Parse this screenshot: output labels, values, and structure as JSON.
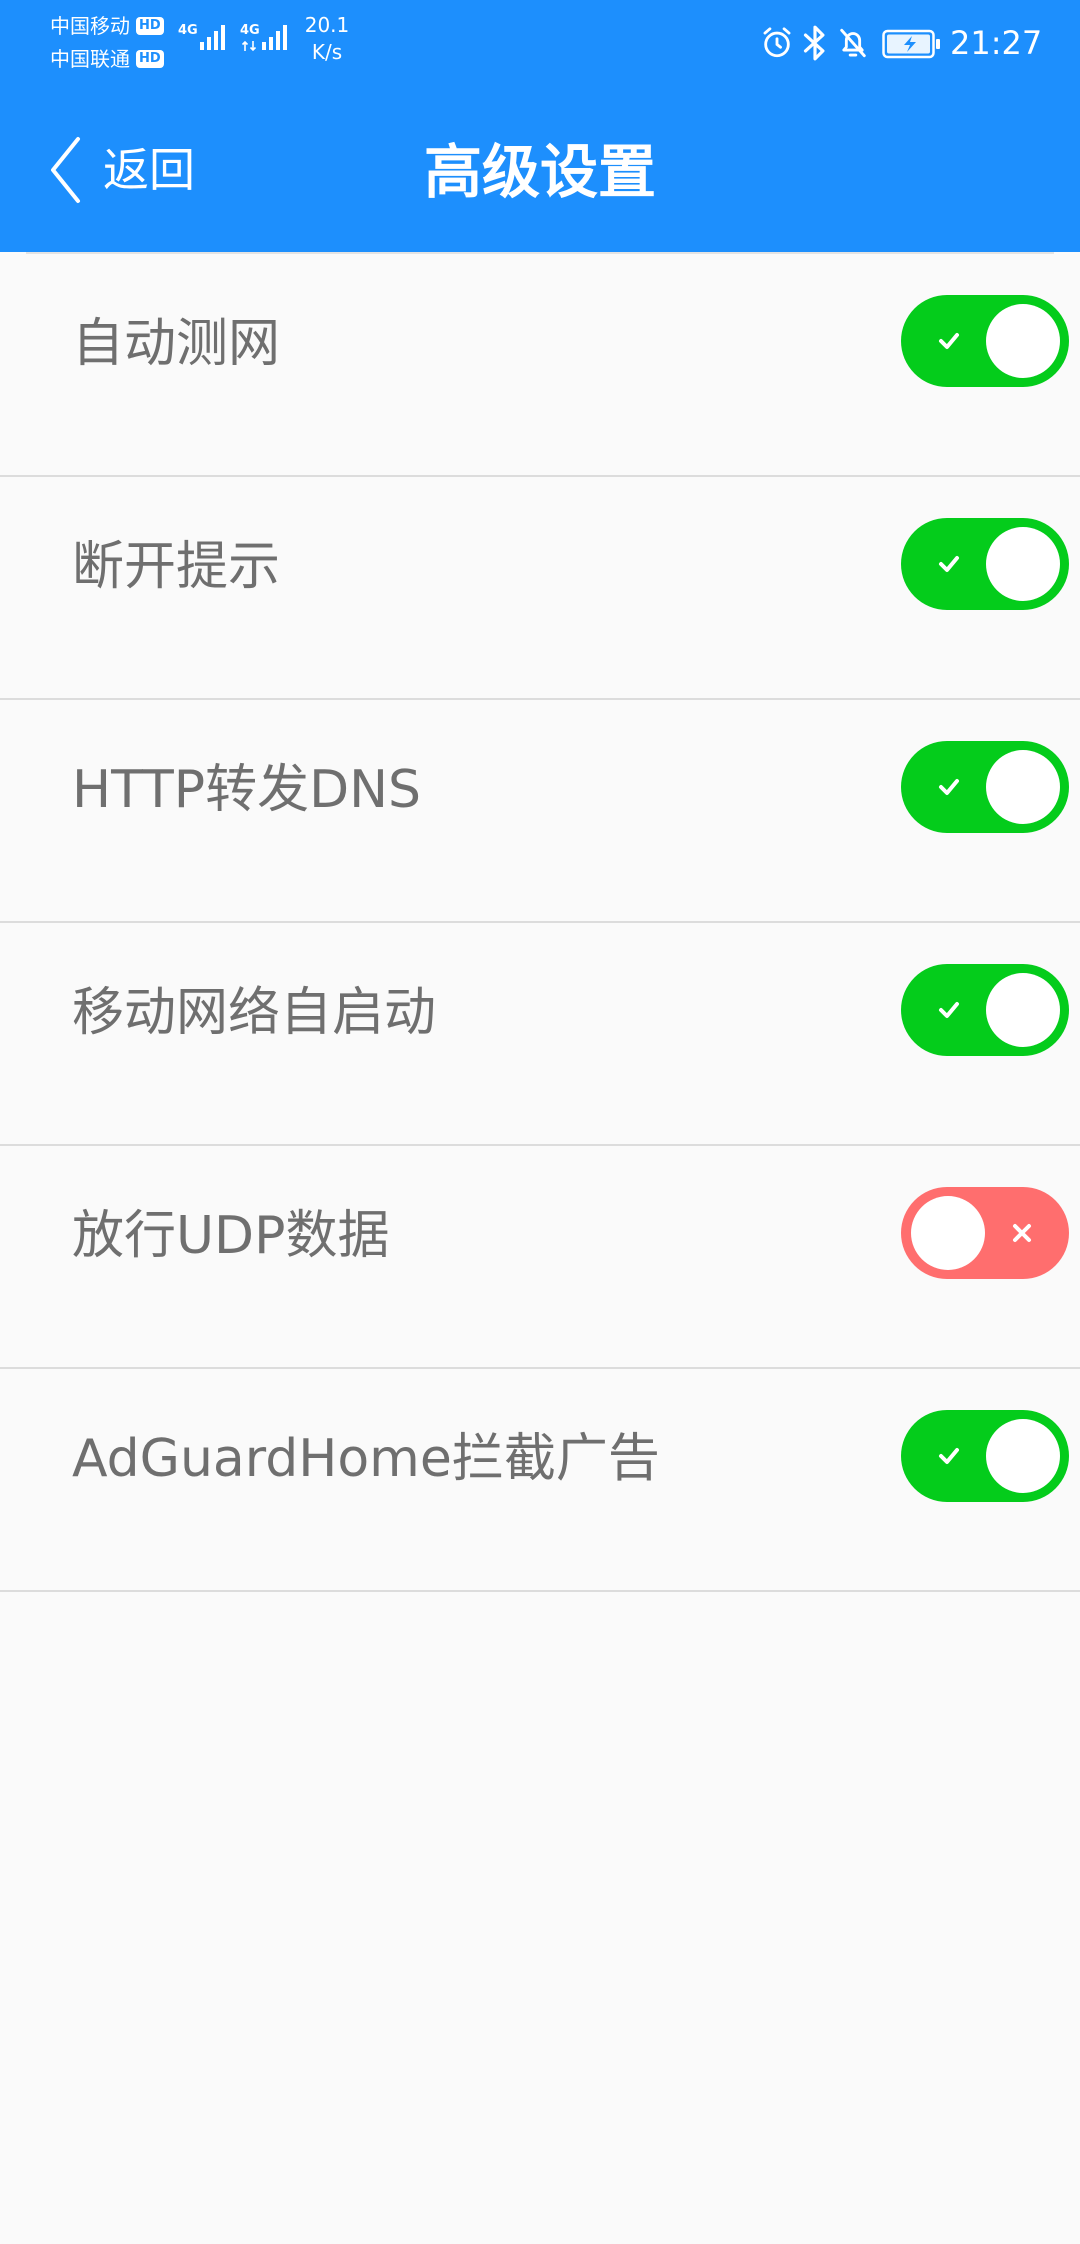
{
  "colors": {
    "header_background": "#1d8ffd",
    "toggle_on": "#04cc1b",
    "toggle_off": "#ff6e6e",
    "label_text": "#6f6f6f",
    "page_background": "#fafafa"
  },
  "status_bar": {
    "carriers": [
      {
        "name": "中国移动",
        "badge": "HD"
      },
      {
        "name": "中国联通",
        "badge": "HD"
      }
    ],
    "networks": [
      "4G",
      "4G"
    ],
    "speed": {
      "value": "20.1",
      "unit": "K/s"
    },
    "icons": [
      "alarm-icon",
      "bluetooth-icon",
      "bell-off-icon",
      "battery-charging-icon"
    ],
    "time": "21:27"
  },
  "nav": {
    "back_icon": "chevron-left-icon",
    "back_label": "返回",
    "title": "高级设置"
  },
  "toggle_icons": {
    "on": "check-icon",
    "off": "close-icon"
  },
  "settings": [
    {
      "label": "自动测网",
      "enabled": true
    },
    {
      "label": "断开提示",
      "enabled": true
    },
    {
      "label": "HTTP转发DNS",
      "enabled": true
    },
    {
      "label": "移动网络自启动",
      "enabled": true
    },
    {
      "label": "放行UDP数据",
      "enabled": false
    },
    {
      "label": "AdGuardHome拦截广告",
      "enabled": true
    }
  ]
}
